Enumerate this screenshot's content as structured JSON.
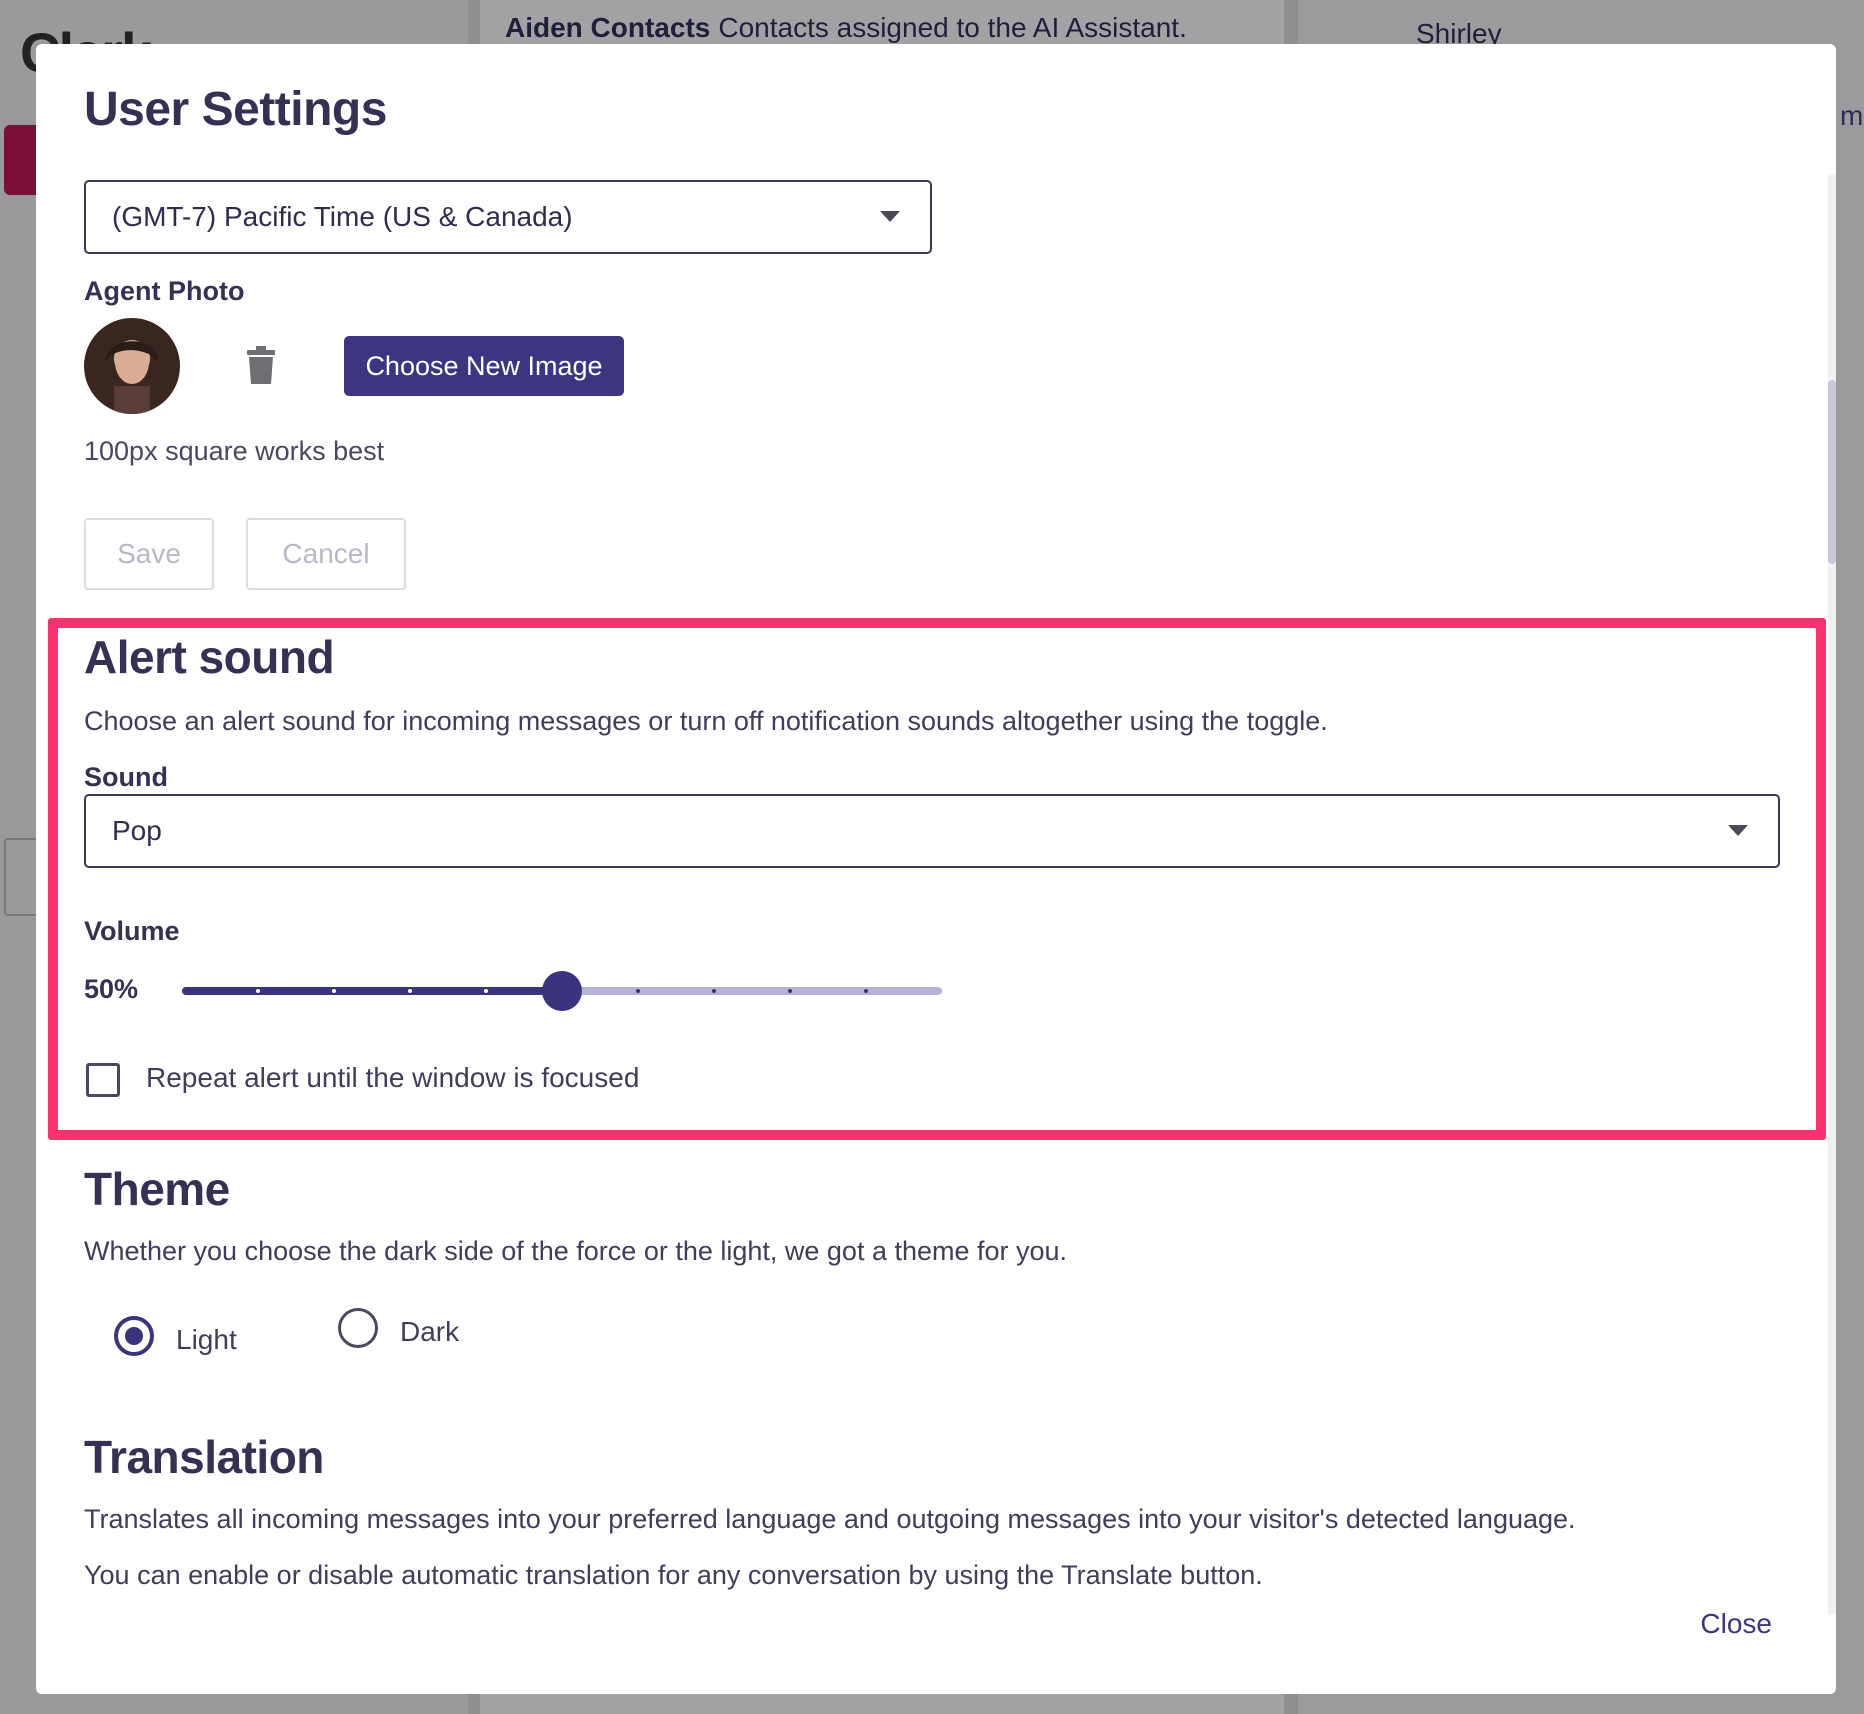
{
  "background": {
    "logo": "Clark",
    "header_title": "Aiden Contacts",
    "header_subtitle": "Contacts assigned to the AI Assistant.",
    "right_name": "Shirley",
    "right_link": "m"
  },
  "modal": {
    "title": "User Settings",
    "timezone": {
      "value": "(GMT-7) Pacific Time (US & Canada)"
    },
    "agent_photo": {
      "label": "Agent Photo",
      "choose_button": "Choose New Image",
      "hint": "100px square works best"
    },
    "actions": {
      "save": "Save",
      "cancel": "Cancel"
    },
    "alert_sound": {
      "heading": "Alert sound",
      "description": "Choose an alert sound for incoming messages or turn off notification sounds altogether using the toggle.",
      "sound_label": "Sound",
      "sound_value": "Pop",
      "volume_label": "Volume",
      "volume_text": "50%",
      "volume_value": 50,
      "volume_step": 10,
      "repeat_label": "Repeat alert until the window is focused",
      "repeat_checked": false
    },
    "theme": {
      "heading": "Theme",
      "description": "Whether you choose the dark side of the force or the light, we got a theme for you.",
      "options": [
        {
          "label": "Light",
          "selected": true
        },
        {
          "label": "Dark",
          "selected": false
        }
      ]
    },
    "translation": {
      "heading": "Translation",
      "description1": "Translates all incoming messages into your preferred language and outgoing messages into your visitor's detected language.",
      "description2": "You can enable or disable automatic translation for any conversation by using the Translate button."
    },
    "close_label": "Close"
  },
  "colors": {
    "accent": "#3d3582",
    "highlight": "#fe3170",
    "slider_track": "#b6b3d6"
  },
  "icons": {
    "trash": "trash-icon",
    "dropdown": "chevron-down-icon"
  }
}
